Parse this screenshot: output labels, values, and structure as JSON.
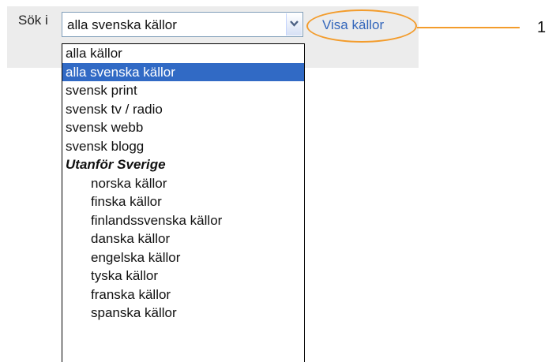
{
  "search": {
    "label": "Sök i",
    "selected_value": "alla svenska källor",
    "show_sources_link": "Visa källor"
  },
  "dropdown": {
    "options": [
      {
        "label": "alla källor"
      },
      {
        "label": "alla svenska källor"
      },
      {
        "label": "svensk print"
      },
      {
        "label": "svensk tv / radio"
      },
      {
        "label": "svensk webb"
      },
      {
        "label": "svensk blogg"
      },
      {
        "label": "Utanför Sverige"
      },
      {
        "label": "norska källor"
      },
      {
        "label": "finska källor"
      },
      {
        "label": "finlandssvenska källor"
      },
      {
        "label": "danska källor"
      },
      {
        "label": "engelska källor"
      },
      {
        "label": "tyska källor"
      },
      {
        "label": "franska källor"
      },
      {
        "label": "spanska källor"
      }
    ]
  },
  "callout": {
    "number": "1",
    "color": "#f39c2c"
  },
  "colors": {
    "selection_highlight": "#316ac5",
    "link": "#3366bb",
    "bar_background": "#ececec"
  },
  "icons": {
    "select_arrow": "chevron-down-icon"
  }
}
